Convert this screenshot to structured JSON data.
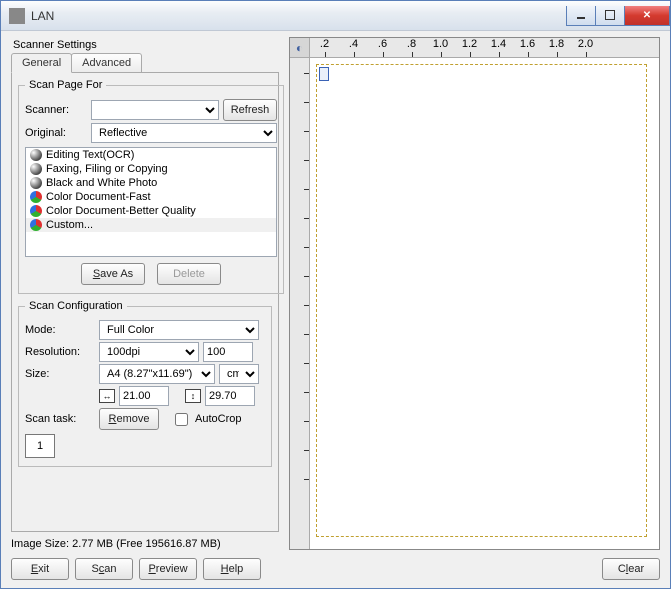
{
  "window": {
    "title": "LAN"
  },
  "panel_title": "Scanner Settings",
  "tabs": {
    "general": "General",
    "advanced": "Advanced"
  },
  "scan_page_for": {
    "legend": "Scan Page For",
    "scanner_label": "Scanner:",
    "scanner_value": "",
    "refresh": "Refresh",
    "original_label": "Original:",
    "original_value": "Reflective",
    "items": [
      {
        "label": "Editing Text(OCR)",
        "icon": "bw"
      },
      {
        "label": "Faxing, Filing or Copying",
        "icon": "bw"
      },
      {
        "label": "Black and White Photo",
        "icon": "bw"
      },
      {
        "label": "Color Document-Fast",
        "icon": "col"
      },
      {
        "label": "Color Document-Better Quality",
        "icon": "col"
      },
      {
        "label": "Custom...",
        "icon": "col",
        "selected": true
      }
    ],
    "save_as": "Save As",
    "delete": "Delete"
  },
  "scan_config": {
    "legend": "Scan Configuration",
    "mode_label": "Mode:",
    "mode_value": "Full Color",
    "res_label": "Resolution:",
    "res_dropdown": "100dpi",
    "res_value": "100",
    "size_label": "Size:",
    "size_preset": "A4 (8.27\"x11.69\")",
    "size_unit": "cm",
    "width_value": "21.00",
    "height_value": "29.70",
    "scan_task_label": "Scan task:",
    "remove": "Remove",
    "autocrop": "AutoCrop",
    "task_count": "1"
  },
  "status": "Image Size: 2.77 MB (Free 195616.87 MB)",
  "ruler": {
    "values": [
      ".2",
      ".4",
      ".6",
      ".8",
      "1.0",
      "1.2",
      "1.4",
      "1.6",
      "1.8",
      "2.0"
    ]
  },
  "buttons": {
    "exit": "Exit",
    "scan": "Scan",
    "preview": "Preview",
    "help": "Help",
    "clear": "Clear"
  }
}
